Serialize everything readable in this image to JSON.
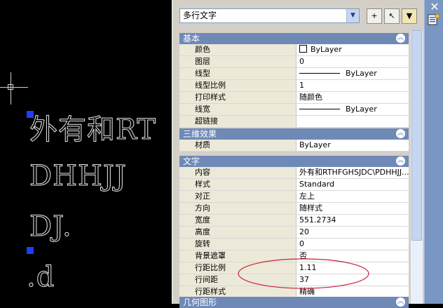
{
  "canvas": {
    "text_lines": [
      "外有和RT",
      "DHHJJ",
      "DJ.",
      ".d"
    ]
  },
  "palette": {
    "selector": {
      "value": "多行文字"
    },
    "toolbar": {
      "btn_select_label": "+",
      "btn_pick_label": "↖",
      "btn_filter_label": "▼"
    },
    "close_label": "✕",
    "sections": [
      {
        "title": "基本",
        "rows": [
          {
            "label": "颜色",
            "value": "ByLayer"
          },
          {
            "label": "图层",
            "value": "0"
          },
          {
            "label": "线型",
            "value": "ByLayer"
          },
          {
            "label": "线型比例",
            "value": "1"
          },
          {
            "label": "打印样式",
            "value": "随颜色"
          },
          {
            "label": "线宽",
            "value": "ByLayer"
          },
          {
            "label": "超链接",
            "value": ""
          }
        ]
      },
      {
        "title": "三维效果",
        "rows": [
          {
            "label": "材质",
            "value": "ByLayer"
          }
        ]
      },
      {
        "title": "文字",
        "rows": [
          {
            "label": "内容",
            "value": "外有和RTHFGHSJDC\\PDHHJJ..."
          },
          {
            "label": "样式",
            "value": "Standard"
          },
          {
            "label": "对正",
            "value": "左上"
          },
          {
            "label": "方向",
            "value": "随样式"
          },
          {
            "label": "宽度",
            "value": "551.2734"
          },
          {
            "label": "高度",
            "value": "20"
          },
          {
            "label": "旋转",
            "value": "0"
          },
          {
            "label": "背景遮罩",
            "value": "否"
          },
          {
            "label": "行距比例",
            "value": "1.11"
          },
          {
            "label": "行间距",
            "value": "37"
          },
          {
            "label": "行距样式",
            "value": "精确"
          }
        ]
      },
      {
        "title": "几何图形",
        "rows": []
      }
    ]
  },
  "colors": {
    "section_header": "#6f89b7",
    "highlight_ellipse": "#c8203a",
    "grip": "#1f3cff"
  }
}
